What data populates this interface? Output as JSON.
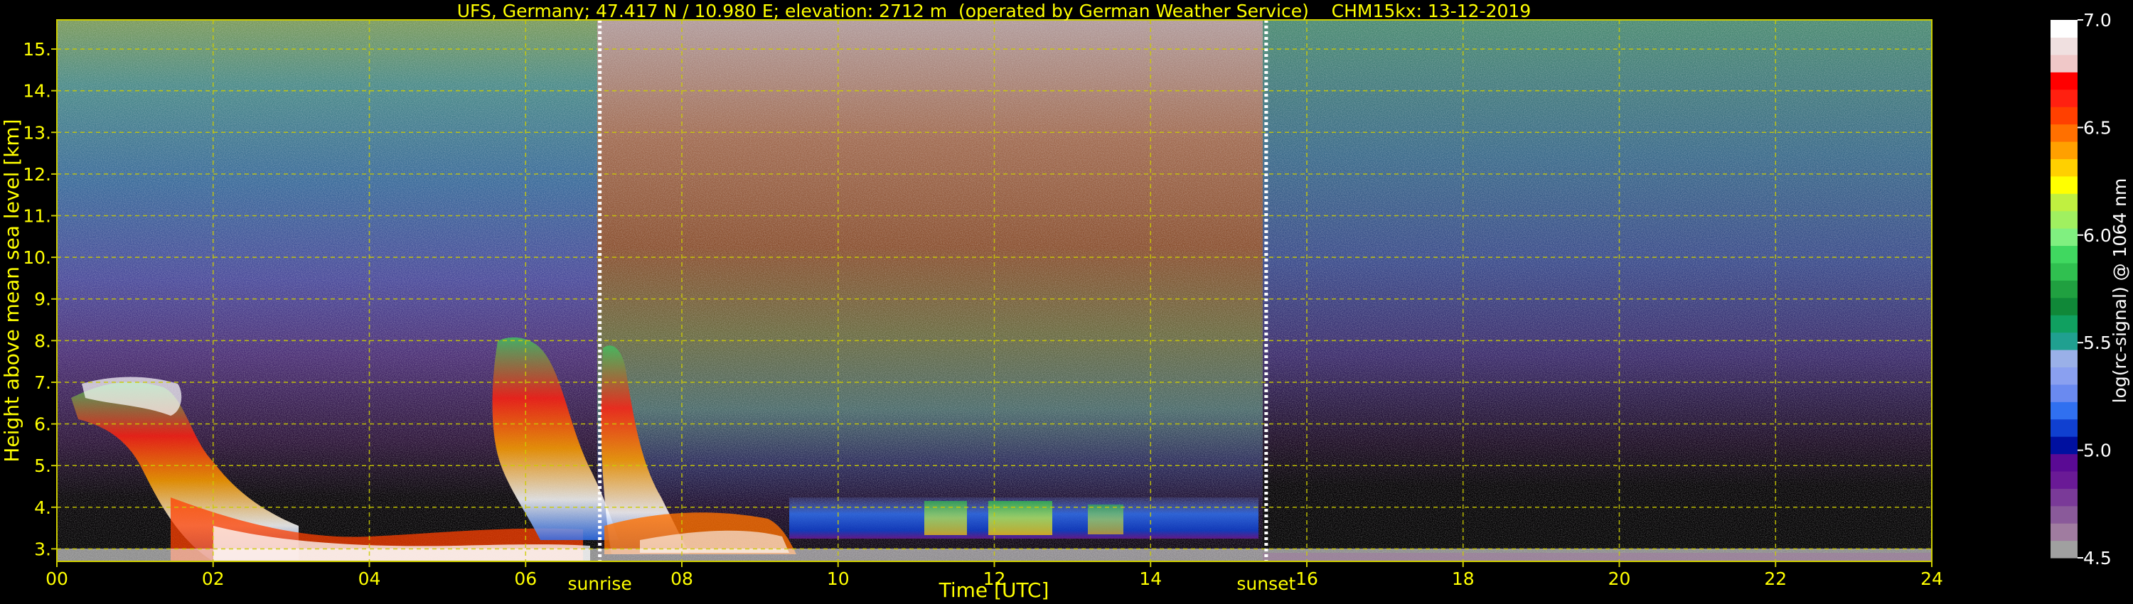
{
  "chart_data": {
    "type": "heatmap",
    "title": "UFS, Germany; 47.417 N / 10.980 E; elevation: 2712 m  (operated by German Weather Service)    CHM15kx: 13-12-2019",
    "xlabel": "Time [UTC]",
    "ylabel": "Height above mean sea level [km]",
    "xlim": [
      0,
      24
    ],
    "ylim": [
      2.7,
      15.7
    ],
    "x_ticks": [
      "00",
      "02",
      "04",
      "06",
      "08",
      "10",
      "12",
      "14",
      "16",
      "18",
      "20",
      "22",
      "24"
    ],
    "x_tick_values": [
      0,
      2,
      4,
      6,
      8,
      10,
      12,
      14,
      16,
      18,
      20,
      22,
      24
    ],
    "y_ticks": [
      "3.",
      "4.",
      "5.",
      "6.",
      "7.",
      "8.",
      "9.",
      "10.",
      "11.",
      "12.",
      "13.",
      "14.",
      "15."
    ],
    "y_tick_values": [
      3,
      4,
      5,
      6,
      7,
      8,
      9,
      10,
      11,
      12,
      13,
      14,
      15
    ],
    "grid": true,
    "annotations": [
      {
        "text": "sunrise",
        "x": 6.95
      },
      {
        "text": "sunset",
        "x": 15.48
      }
    ],
    "colorbar": {
      "label": "log(rc-signal) @ 1064 nm",
      "range": [
        4.5,
        7.0
      ],
      "ticks": [
        "4.5",
        "5.0",
        "5.5",
        "6.0",
        "6.5",
        "7.0"
      ],
      "tick_values": [
        4.5,
        5.0,
        5.5,
        6.0,
        6.5,
        7.0
      ],
      "colors": [
        "#a0a0a0",
        "#a07ca0",
        "#8a5a9a",
        "#7a3a98",
        "#6a1a96",
        "#5a0a94",
        "#0010a0",
        "#1040d0",
        "#3070f0",
        "#6a8af0",
        "#8aa0f0",
        "#9ab0e8",
        "#20a090",
        "#10a060",
        "#108838",
        "#20a040",
        "#30c050",
        "#40d860",
        "#80f080",
        "#a0f060",
        "#c0f040",
        "#ffff00",
        "#ffd000",
        "#ffa000",
        "#ff7000",
        "#ff4000",
        "#ff2010",
        "#ff0000",
        "#f0c8c8",
        "#f0e0e0",
        "#ffffff"
      ]
    }
  }
}
